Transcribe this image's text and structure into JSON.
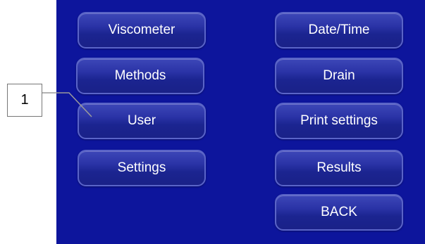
{
  "left_column": [
    {
      "label": "Viscometer"
    },
    {
      "label": "Methods"
    },
    {
      "label": "User"
    },
    {
      "label": "Settings"
    }
  ],
  "right_column": [
    {
      "label": "Date/Time"
    },
    {
      "label": "Drain"
    },
    {
      "label": "Print settings"
    },
    {
      "label": "Results"
    },
    {
      "label": "BACK"
    }
  ],
  "callout": {
    "number": "1"
  },
  "colors": {
    "screen_background": "#0d159c",
    "button_fill": "#2a33a6",
    "button_border": "#5a64c8",
    "button_text": "#ffffff"
  }
}
